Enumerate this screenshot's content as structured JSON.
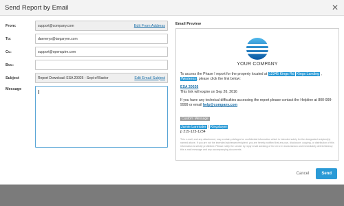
{
  "modal": {
    "title": "Send Report by Email",
    "close_icon": "close-icon"
  },
  "form": {
    "from_label": "From:",
    "from_value": "support@company.com",
    "edit_from_label": "Edit From Address",
    "to_label": "To:",
    "to_value": "daenerys@targaryen.com",
    "cc_label": "Cc:",
    "cc_value": "support@openqutre.com",
    "bcc_label": "Bcc:",
    "bcc_value": "",
    "subject_label": "Subject",
    "subject_value": "Report Download: ESA 20026 - Sept of Baelor",
    "edit_subject_label": "Edit Email Subject",
    "message_label": "Message",
    "message_value": ""
  },
  "preview": {
    "title": "Email Preview",
    "company_name": "YOUR COMPANY",
    "intro": "To access the Phase I report for the property located at",
    "address_highlight": "12345 Kings Rd",
    "city_highlight": "Kings Landing",
    "state_highlight": "Westeros",
    "intro_end": ", please click the link below:",
    "esa_link": "ESA 20026",
    "expires": "This link will expire on Sep 26, 2016",
    "help_text": "If you have any technical difficulties accessing the report please contact the Helpline at 800-999-9999 or email",
    "help_email": "help@company.com",
    "custom_message": "Custom Message",
    "sender_name": "Jamie Lannister",
    "sender_company": "Kingslayer",
    "sender_phone": "p 215-123-1234",
    "disclaimer": "This e-mail, and any attachment, may contain privileged or confidential information which is intended solely for the designated recipient(s) named above. If you are not the intended addressee/recipient, you are hereby notified that any use, disclosure, copying, or distribution of this information is strictly prohibited. Please notify the sender by reply email advising of the error in transmission and immediately delete/destroy this e-mail message and any accompanying documents."
  },
  "footer": {
    "cancel_label": "Cancel",
    "send_label": "Send"
  },
  "colors": {
    "accent": "#2a9ad6",
    "link": "#1a6fa8",
    "overlay": "#7b7b7b"
  }
}
